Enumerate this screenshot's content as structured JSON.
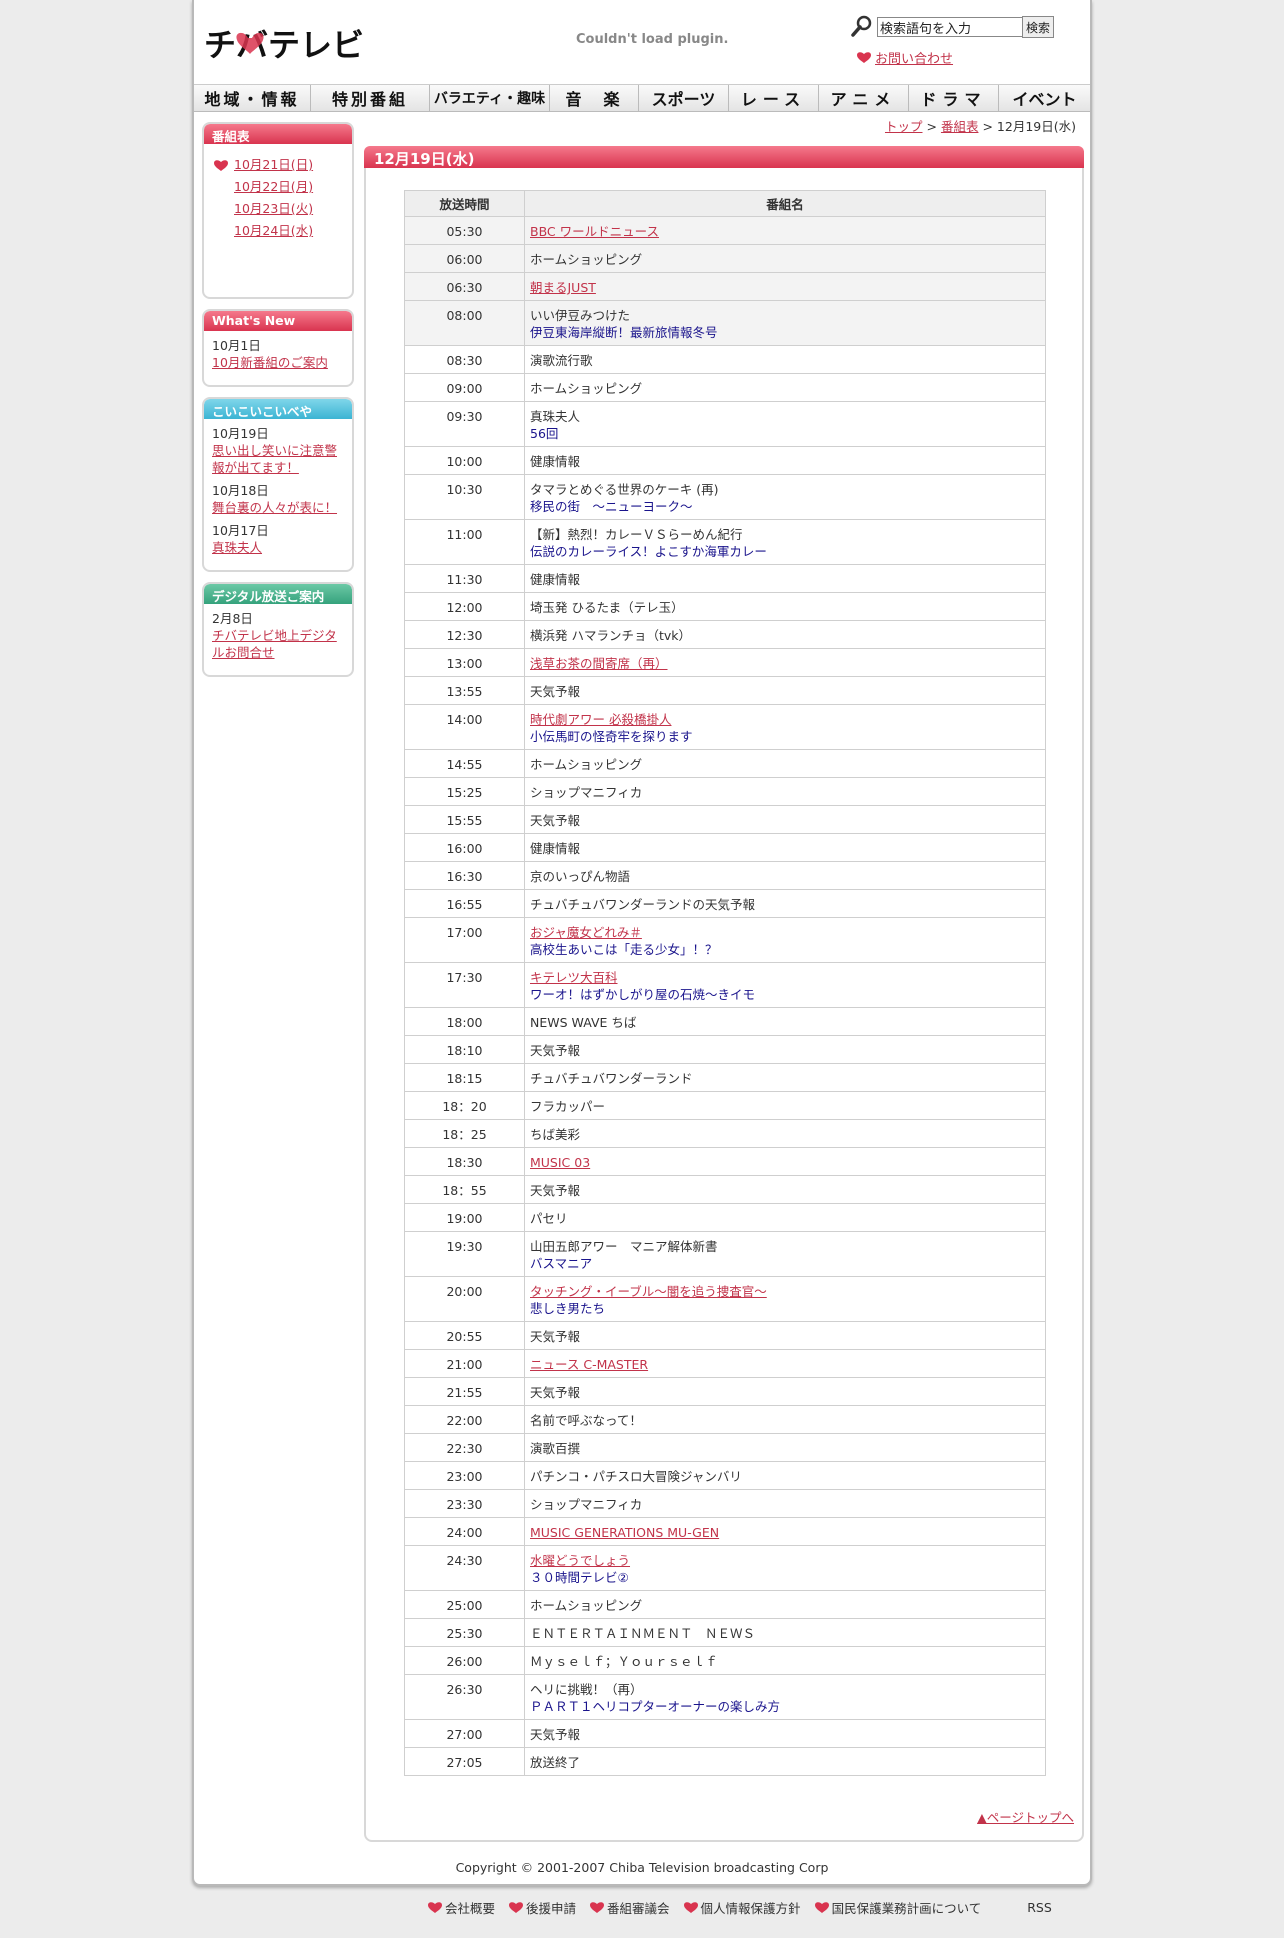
{
  "header": {
    "logo": "チバテレビ",
    "plugin_msg": "Couldn't load plugin.",
    "search_placeholder": "検索語句を入力",
    "search_button": "検索",
    "contact_link": "お問い合わせ"
  },
  "nav": [
    "地域・情報",
    "特別番組",
    "バラエティ・趣味",
    "音　楽",
    "スポーツ",
    "レース",
    "アニメ",
    "ドラマ",
    "イベント"
  ],
  "sidebar": {
    "schedule": {
      "title": "番組表",
      "days": [
        "10月21日(日)",
        "10月22日(月)",
        "10月23日(火)",
        "10月24日(水)"
      ]
    },
    "whatsnew": {
      "title": "What's New",
      "items": [
        {
          "date": "10月1日",
          "link": "10月新番組のご案内"
        }
      ]
    },
    "koikoi": {
      "title": "こいこいこいべや",
      "items": [
        {
          "date": "10月19日",
          "link": "思い出し笑いに注意警報が出てます！"
        },
        {
          "date": "10月18日",
          "link": "舞台裏の人々が表に！"
        },
        {
          "date": "10月17日",
          "link": "真珠夫人"
        }
      ]
    },
    "digital": {
      "title": "デジタル放送ご案内",
      "items": [
        {
          "date": "2月8日",
          "link": "チバテレビ地上デジタルお問合せ"
        }
      ]
    }
  },
  "breadcrumb": {
    "top": "トップ",
    "schedule": "番組表",
    "current": "12月19日(水)",
    "sep": ">"
  },
  "panel_title": "12月19日(水)",
  "table": {
    "headers": [
      "放送時間",
      "番組名"
    ],
    "rows": [
      {
        "time": "05:30",
        "title": "BBC ワールドニュース",
        "link": true,
        "shade": true
      },
      {
        "time": "06:00",
        "title": "ホームショッピング",
        "shade": true
      },
      {
        "time": "06:30",
        "title": "朝まるJUST",
        "link": true,
        "shade": true
      },
      {
        "time": "08:00",
        "title": "いい伊豆みつけた",
        "sub": "伊豆東海岸縦断！最新旅情報冬号",
        "shade": true
      },
      {
        "time": "08:30",
        "title": "演歌流行歌"
      },
      {
        "time": "09:00",
        "title": "ホームショッピング"
      },
      {
        "time": "09:30",
        "title": "真珠夫人",
        "sub": "56回"
      },
      {
        "time": "10:00",
        "title": "健康情報"
      },
      {
        "time": "10:30",
        "title": "タマラとめぐる世界のケーキ (再)",
        "sub": "移民の街　～ニューヨーク～"
      },
      {
        "time": "11:00",
        "title": "【新】熱烈！カレーＶＳらーめん紀行",
        "sub": "伝説のカレーライス！よこすか海軍カレー"
      },
      {
        "time": "11:30",
        "title": "健康情報"
      },
      {
        "time": "12:00",
        "title": "埼玉発 ひるたま（テレ玉）"
      },
      {
        "time": "12:30",
        "title": "横浜発 ハマランチョ（tvk）"
      },
      {
        "time": "13:00",
        "title": "浅草お茶の間寄席（再）",
        "link": true
      },
      {
        "time": "13:55",
        "title": "天気予報"
      },
      {
        "time": "14:00",
        "title": "時代劇アワー 必殺橋掛人",
        "link": true,
        "sub": "小伝馬町の怪奇牢を探ります"
      },
      {
        "time": "14:55",
        "title": "ホームショッピング"
      },
      {
        "time": "15:25",
        "title": "ショップマニフィカ"
      },
      {
        "time": "15:55",
        "title": "天気予報"
      },
      {
        "time": "16:00",
        "title": "健康情報"
      },
      {
        "time": "16:30",
        "title": "京のいっぴん物語"
      },
      {
        "time": "16:55",
        "title": "チュバチュバワンダーランドの天気予報"
      },
      {
        "time": "17:00",
        "title": "おジャ魔女どれみ＃",
        "link": true,
        "sub": "高校生あいこは「走る少女」！？"
      },
      {
        "time": "17:30",
        "title": "キテレツ大百科",
        "link": true,
        "sub": "ワーオ！はずかしがり屋の石焼～きイモ"
      },
      {
        "time": "18:00",
        "title": "NEWS WAVE ちば"
      },
      {
        "time": "18:10",
        "title": "天気予報"
      },
      {
        "time": "18:15",
        "title": "チュバチュバワンダーランド"
      },
      {
        "time": "18：20",
        "title": "フラカッパー"
      },
      {
        "time": "18：25",
        "title": "ちば美彩"
      },
      {
        "time": "18:30",
        "title": "MUSIC 03",
        "link": true
      },
      {
        "time": "18：55",
        "title": "天気予報"
      },
      {
        "time": "19:00",
        "title": "パセリ"
      },
      {
        "time": "19:30",
        "title": "山田五郎アワー　マニア解体新書",
        "sub": "バスマニア"
      },
      {
        "time": "20:00",
        "title": "タッチング・イーブル～闇を追う捜査官～",
        "link": true,
        "sub": "悲しき男たち"
      },
      {
        "time": "20:55",
        "title": "天気予報"
      },
      {
        "time": "21:00",
        "title": "ニュース C-MASTER",
        "link": true
      },
      {
        "time": "21:55",
        "title": "天気予報"
      },
      {
        "time": "22:00",
        "title": "名前で呼ぶなって！"
      },
      {
        "time": "22:30",
        "title": "演歌百撰"
      },
      {
        "time": "23:00",
        "title": "パチンコ・パチスロ大冒険ジャンバリ"
      },
      {
        "time": "23:30",
        "title": "ショップマニフィカ"
      },
      {
        "time": "24:00",
        "title": "MUSIC GENERATIONS MU-GEN",
        "link": true
      },
      {
        "time": "24:30",
        "title": "水曜どうでしょう",
        "link": true,
        "sub": "３０時間テレビ②"
      },
      {
        "time": "25:00",
        "title": "ホームショッピング"
      },
      {
        "time": "25:30",
        "title": "ＥＮＴＥＲＴＡＩＮＭＥＮＴ　ＮＥＷＳ"
      },
      {
        "time": "26:00",
        "title": "Ｍｙｓｅｌｆ；Ｙｏｕｒｓｅｌｆ"
      },
      {
        "time": "26:30",
        "title": "ヘリに挑戦！（再）",
        "sub": "ＰＡＲＴ１ヘリコプターオーナーの楽しみ方"
      },
      {
        "time": "27:00",
        "title": "天気予報"
      },
      {
        "time": "27:05",
        "title": "放送終了"
      }
    ]
  },
  "pagetop": "▲ページトップへ",
  "copyright": "Copyright © 2001-2007 Chiba Television broadcasting Corp",
  "footer": {
    "links": [
      "会社概要",
      "後援申請",
      "番組審議会",
      "個人情報保護方針",
      "国民保護業務計画について"
    ],
    "rss": "RSS"
  },
  "colors": {
    "accent": "#d9344f",
    "link": "#c2334a",
    "sub": "#1a148c"
  }
}
